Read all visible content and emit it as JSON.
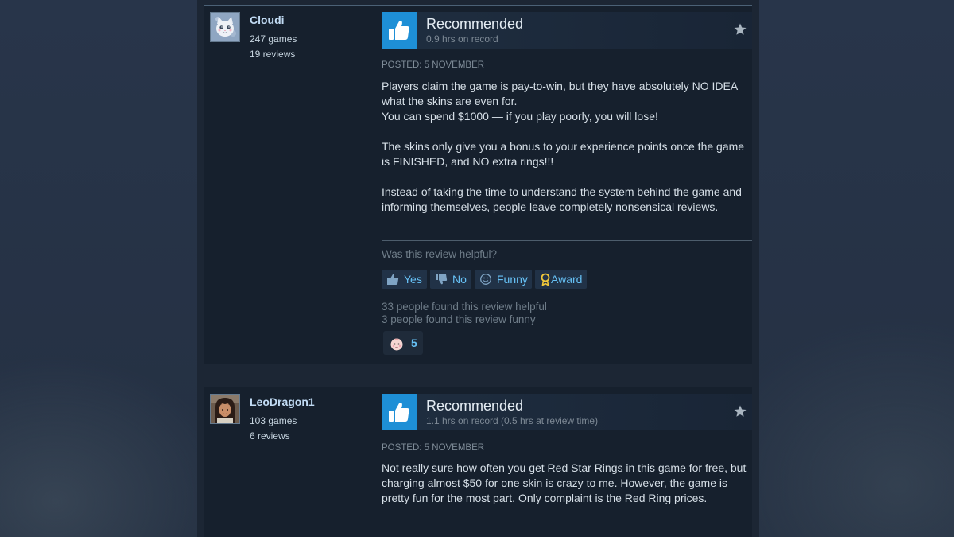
{
  "reviews": [
    {
      "author": {
        "name": "Cloudi",
        "games": "247 games",
        "reviews": "19 reviews"
      },
      "verdict": "Recommended",
      "hours": "0.9 hrs on record",
      "posted": "POSTED: 5 NOVEMBER",
      "paragraphs": [
        "Players claim the game is pay-to-win, but they have absolutely NO IDEA what the skins are even for.\nYou can spend $1000 — if you play poorly, you will lose!",
        "The skins only give you a bonus to your experience points once the game is FINISHED, and NO extra rings!!!",
        "Instead of taking the time to understand the system behind the game and informing themselves, people leave completely nonsensical reviews."
      ],
      "helpful_question": "Was this review helpful?",
      "buttons": {
        "yes": "Yes",
        "no": "No",
        "funny": "Funny",
        "award": "Award"
      },
      "helpful_count": "33 people found this review helpful",
      "funny_count": "3 people found this review funny",
      "award_count": "5",
      "icons": {
        "avatar": "cat-avatar",
        "verdict": "thumbs-up-icon",
        "star": "star-icon",
        "yes": "thumbs-up-icon",
        "no": "thumbs-down-icon",
        "funny": "smiley-icon",
        "award": "award-ribbon-icon",
        "reaction": "baby-face-icon"
      }
    },
    {
      "author": {
        "name": "LeoDragon1",
        "games": "103 games",
        "reviews": "6 reviews"
      },
      "verdict": "Recommended",
      "hours": "1.1 hrs on record (0.5 hrs at review time)",
      "posted": "POSTED: 5 NOVEMBER",
      "paragraphs": [
        "Not really sure how often you get Red Star Rings in this game for free, but charging almost $50 for one skin is crazy to me. However, the game is pretty fun for the most part. Only complaint is the Red Ring prices."
      ],
      "icons": {
        "avatar": "portrait-avatar",
        "verdict": "thumbs-up-icon",
        "star": "star-icon"
      }
    }
  ],
  "colors": {
    "page_bg": "#263242",
    "column_bg": "#1c2634",
    "review_bg": "#16202d",
    "thumb_blue": "#1e8fd6",
    "link_blue": "#66c0f4",
    "author_name": "#c1dbf4",
    "body_text": "#d6dfe7",
    "muted_text": "#7f8c98"
  }
}
